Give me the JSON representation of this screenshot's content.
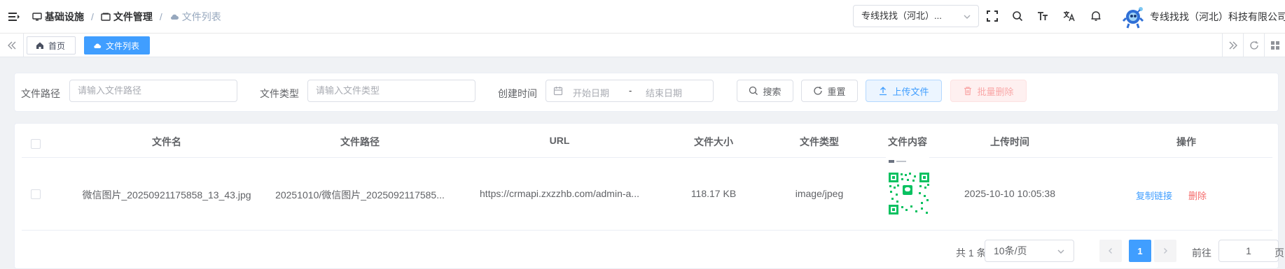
{
  "header": {
    "breadcrumb": [
      {
        "label": "基础设施"
      },
      {
        "label": "文件管理"
      },
      {
        "label": "文件列表"
      }
    ],
    "org_select_value": "专线找找（河北）...",
    "org_name": "专线找找（河北）科技有限公司",
    "icons": [
      "fullscreen-icon",
      "search-icon",
      "font-size-icon",
      "translate-icon",
      "bell-icon"
    ]
  },
  "tags": {
    "items": [
      {
        "label": "首页",
        "icon": "home-icon",
        "active": false
      },
      {
        "label": "文件列表",
        "icon": "cloud-icon",
        "active": true
      }
    ]
  },
  "search": {
    "path_label": "文件路径",
    "path_placeholder": "请输入文件路径",
    "type_label": "文件类型",
    "type_placeholder": "请输入文件类型",
    "time_label": "创建时间",
    "start_placeholder": "开始日期",
    "range_separator": "-",
    "end_placeholder": "结束日期",
    "search_btn": "搜索",
    "reset_btn": "重置",
    "upload_btn": "上传文件",
    "batch_delete_btn": "批量删除"
  },
  "table": {
    "columns": [
      "文件名",
      "文件路径",
      "URL",
      "文件大小",
      "文件类型",
      "文件内容",
      "上传时间",
      "操作"
    ],
    "rows": [
      {
        "name": "微信图片_20250921175858_13_43.jpg",
        "path": "20251010/微信图片_2025092117585...",
        "url": "https://crmapi.zxzzhb.com/admin-a...",
        "size": "118.17 KB",
        "type": "image/jpeg",
        "upload_time": "2025-10-10 10:05:38",
        "actions": {
          "copy": "复制链接",
          "delete": "删除"
        }
      }
    ]
  },
  "pagination": {
    "total": "共 1 条",
    "page_size": "10条/页",
    "current": "1",
    "goto_label": "前往",
    "goto_value": "1",
    "page_suffix": "页"
  },
  "colors": {
    "primary": "#409eff",
    "danger": "#f56c6c"
  }
}
